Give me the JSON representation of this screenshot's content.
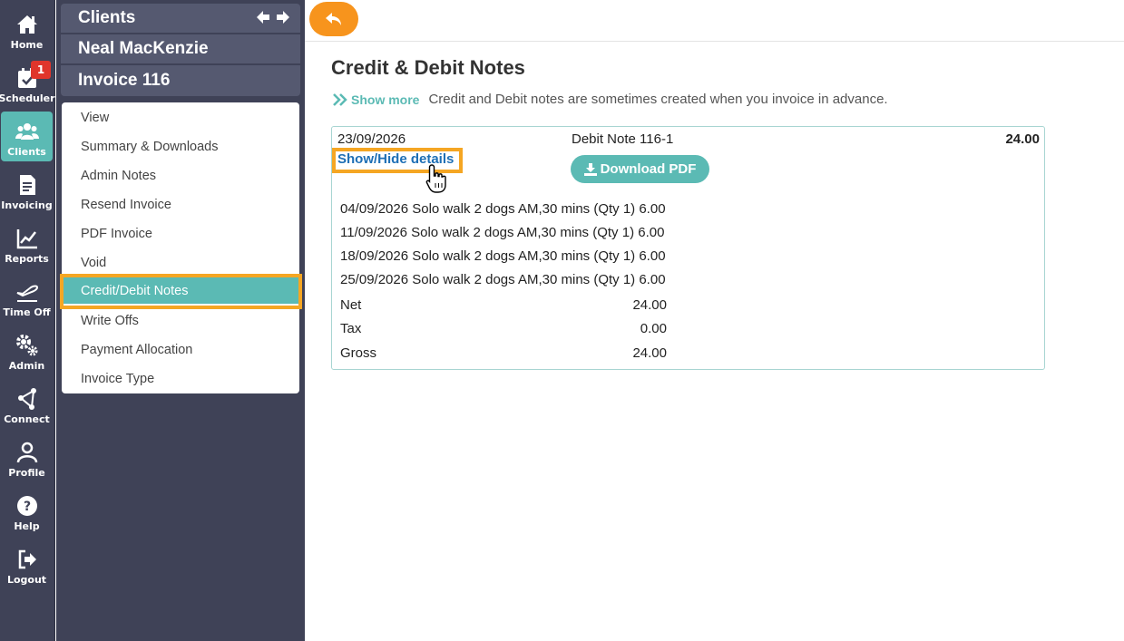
{
  "rail": {
    "items": [
      {
        "label": "Home",
        "icon": "home-icon"
      },
      {
        "label": "Scheduler",
        "icon": "calendar-check-icon",
        "badge": "1"
      },
      {
        "label": "Clients",
        "icon": "users-icon",
        "active": true
      },
      {
        "label": "Invoicing",
        "icon": "invoice-icon"
      },
      {
        "label": "Reports",
        "icon": "chart-line-icon"
      },
      {
        "label": "Time Off",
        "icon": "plane-icon"
      },
      {
        "label": "Admin",
        "icon": "gears-icon"
      },
      {
        "label": "Connect",
        "icon": "share-nodes-icon"
      },
      {
        "label": "Profile",
        "icon": "user-icon"
      },
      {
        "label": "Help",
        "icon": "question-icon"
      },
      {
        "label": "Logout",
        "icon": "logout-icon"
      }
    ]
  },
  "breadcrumb": {
    "section": "Clients",
    "client": "Neal MacKenzie",
    "invoice": "Invoice 116"
  },
  "menu": {
    "items": [
      "View",
      "Summary & Downloads",
      "Admin Notes",
      "Resend Invoice",
      "PDF Invoice",
      "Void",
      "Credit/Debit Notes",
      "Write Offs",
      "Payment Allocation",
      "Invoice Type"
    ],
    "active": "Credit/Debit Notes"
  },
  "page": {
    "title": "Credit & Debit Notes",
    "show_more": "Show more",
    "description": "Credit and Debit notes are sometimes created when you invoice in advance."
  },
  "note": {
    "date": "23/09/2026",
    "name": "Debit Note 116-1",
    "amount": "24.00",
    "toggle": "Show/Hide details",
    "download": "Download PDF",
    "lines": [
      "04/09/2026 Solo walk 2 dogs AM,30 mins (Qty 1) 6.00",
      "11/09/2026 Solo walk 2 dogs AM,30 mins (Qty 1) 6.00",
      "18/09/2026 Solo walk 2 dogs AM,30 mins (Qty 1) 6.00",
      "25/09/2026 Solo walk 2 dogs AM,30 mins (Qty 1) 6.00"
    ],
    "net_label": "Net",
    "net": "24.00",
    "tax_label": "Tax",
    "tax": "0.00",
    "gross_label": "Gross",
    "gross": "24.00"
  },
  "colors": {
    "accent": "#5bbab4",
    "highlight": "#f5a623",
    "back_button": "#f7941d",
    "sidebar": "#3f4257",
    "badge": "#e0352b",
    "link": "#1e6fb5"
  }
}
